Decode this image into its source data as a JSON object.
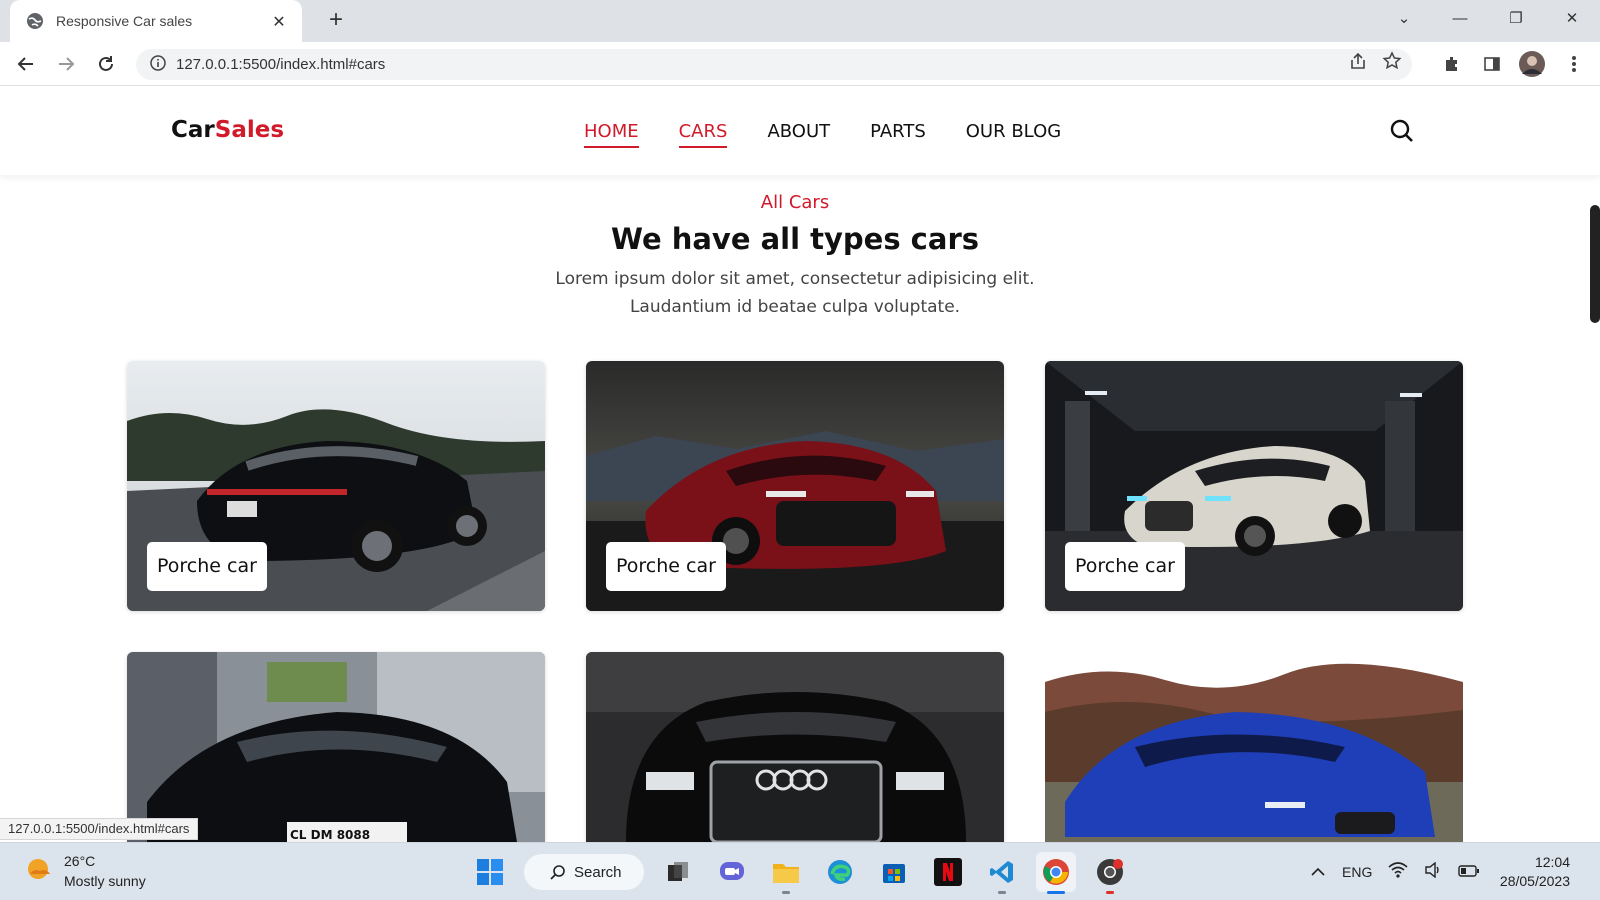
{
  "browser": {
    "tab_title": "Responsive Car sales",
    "tab_close": "✕",
    "new_tab": "+",
    "url": "127.0.0.1:5500/index.html#cars",
    "status_url": "127.0.0.1:5500/index.html#cars",
    "window_controls": {
      "list": "⌄",
      "minimize": "—",
      "restore": "❐",
      "close": "✕"
    }
  },
  "site": {
    "logo_main": "Car",
    "logo_accent": "Sales",
    "nav": [
      {
        "label": "HOME",
        "state": "active"
      },
      {
        "label": "CARS",
        "state": "hover"
      },
      {
        "label": "ABOUT",
        "state": ""
      },
      {
        "label": "PARTS",
        "state": ""
      },
      {
        "label": "OUR BLOG",
        "state": ""
      }
    ],
    "accent_color": "#d11a2a"
  },
  "section": {
    "subtitle": "All Cars",
    "heading": "We have all types cars",
    "lead": "Lorem ipsum dolor sit amet, consectetur adipisicing elit. Laudantium id beatae culpa voluptate."
  },
  "cars": [
    {
      "label": "Porche car",
      "image": "black porsche on highway"
    },
    {
      "label": "Porche car",
      "image": "red audi r8 at dusk"
    },
    {
      "label": "Porche car",
      "image": "white audi in garage"
    },
    {
      "label": "",
      "image": "black audi r8 in street",
      "plate": "CL DM 8088"
    },
    {
      "label": "",
      "image": "black audi a8 front"
    },
    {
      "label": "",
      "image": "blue audi sportback in field"
    }
  ],
  "taskbar": {
    "weather_temp": "26°C",
    "weather_desc": "Mostly sunny",
    "search_label": "Search",
    "lang": "ENG",
    "time": "12:04",
    "date": "28/05/2023",
    "apps": [
      "windows-start",
      "task-view",
      "teams",
      "file-explorer",
      "edge",
      "store",
      "netflix",
      "vscode",
      "chrome",
      "chrome-profile"
    ]
  }
}
